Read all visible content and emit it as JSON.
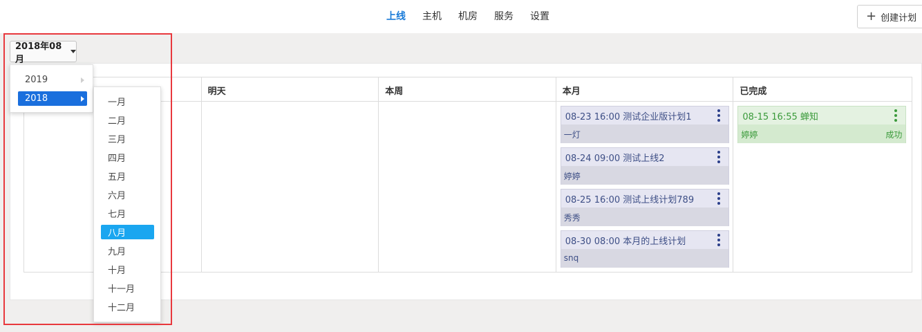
{
  "nav": {
    "items": [
      "上线",
      "主机",
      "机房",
      "服务",
      "设置"
    ],
    "active": 0
  },
  "create_button": {
    "icon": "plus-icon",
    "label": "创建计划"
  },
  "date_selector": {
    "label": "2018年08月"
  },
  "year_menu": {
    "items": [
      "2019",
      "2018"
    ],
    "selected": 1
  },
  "month_menu": {
    "items": [
      "一月",
      "二月",
      "三月",
      "四月",
      "五月",
      "六月",
      "七月",
      "八月",
      "九月",
      "十月",
      "十一月",
      "十二月"
    ],
    "selected": 7
  },
  "columns": [
    {
      "header": "",
      "cards": []
    },
    {
      "header": "明天",
      "cards": []
    },
    {
      "header": "本周",
      "cards": []
    },
    {
      "header": "本月",
      "cards": [
        {
          "title": "08-23 16:00 测试企业版计划1",
          "person": "一灯"
        },
        {
          "title": "08-24 09:00 测试上线2",
          "person": "婷婷"
        },
        {
          "title": "08-25 16:00 测试上线计划789",
          "person": "秀秀"
        },
        {
          "title": "08-30 08:00 本月的上线计划",
          "person": "snq"
        }
      ]
    },
    {
      "header": "已完成",
      "cards": [
        {
          "title": "08-15 16:55 蝉知",
          "person": "婷婷",
          "status": "成功"
        }
      ]
    }
  ],
  "colors": {
    "accent": "#1a7bd8",
    "selected_year": "#1a6fdd",
    "selected_month": "#1aa6f0",
    "highlight": "#e8383d",
    "done_text": "#3a9a3a"
  }
}
